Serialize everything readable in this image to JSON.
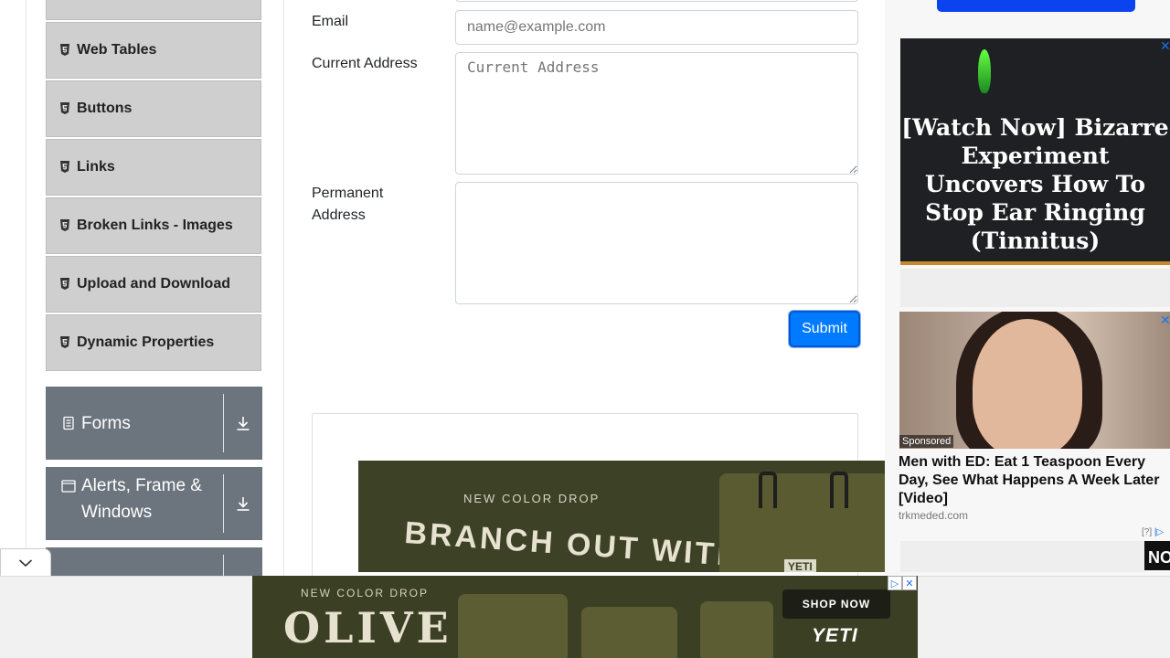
{
  "sidebar": {
    "items": [
      {
        "label": "Web Tables"
      },
      {
        "label": "Buttons"
      },
      {
        "label": "Links"
      },
      {
        "label": "Broken Links - Images"
      },
      {
        "label": "Upload and Download"
      },
      {
        "label": "Dynamic Properties"
      }
    ],
    "groups": [
      {
        "label": "Forms"
      },
      {
        "label": "Alerts, Frame & Windows"
      }
    ]
  },
  "form": {
    "email_label": "Email",
    "email_placeholder": "name@example.com",
    "current_address_label": "Current Address",
    "current_address_placeholder": "Current Address",
    "permanent_address_label": "Permanent Address",
    "permanent_address_placeholder": "",
    "submit_label": "Submit"
  },
  "ads": {
    "inline_caption": "NEW COLOR DROP",
    "inline_headline": "BRANCH OUT WITH",
    "dark_headline": "[Watch Now] Bizarre Experiment Uncovers How To Stop Ear Ringing (Tinnitus)",
    "sponsored": "Sponsored",
    "native_title": "Men with ED: Eat 1 Teaspoon Every Day, See What Happens A Week Later [Video]",
    "native_domain": "trkmeded.com",
    "adinfo": "[?]",
    "corner_text": "NO",
    "bottom_caption": "NEW COLOR DROP",
    "bottom_headline": "OLIVE",
    "bottom_cta": "SHOP NOW",
    "bottom_brand": "YETI",
    "product_brand": "YETI"
  }
}
